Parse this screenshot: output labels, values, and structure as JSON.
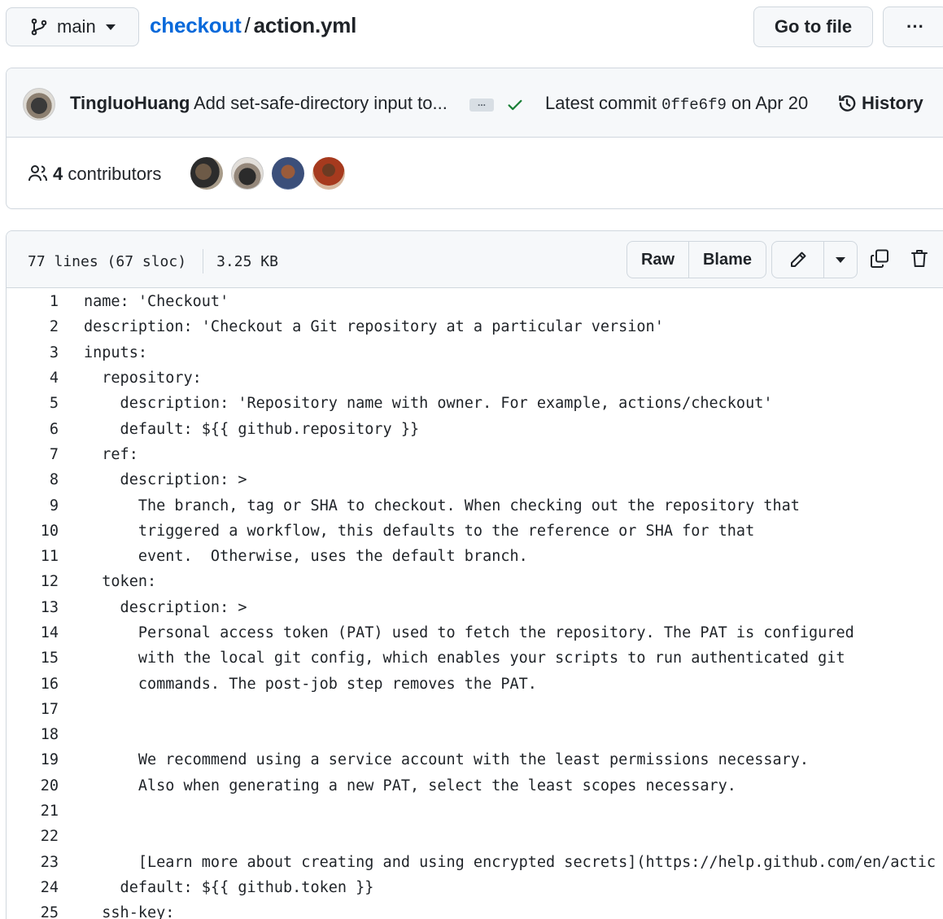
{
  "branch": {
    "name": "main",
    "icon": "git-branch-icon"
  },
  "path": {
    "repo": "checkout",
    "separator": "/",
    "file": "action.yml"
  },
  "toolbar": {
    "goto_file": "Go to file",
    "more": "···"
  },
  "commit": {
    "author": "TingluoHuang",
    "message": "Add set-safe-directory input to...",
    "ellipsis": "...",
    "latest_label": "Latest commit",
    "sha": "0ffe6f9",
    "date": "on Apr 20",
    "history": "History"
  },
  "contributors": {
    "count": "4",
    "label": "contributors"
  },
  "file": {
    "lines_info": "77 lines (67 sloc)",
    "size": "3.25 KB",
    "raw": "Raw",
    "blame": "Blame"
  },
  "code_lines": [
    {
      "n": "1",
      "text": "name: 'Checkout'"
    },
    {
      "n": "2",
      "text": "description: 'Checkout a Git repository at a particular version'"
    },
    {
      "n": "3",
      "text": "inputs:"
    },
    {
      "n": "4",
      "text": "  repository:"
    },
    {
      "n": "5",
      "text": "    description: 'Repository name with owner. For example, actions/checkout'"
    },
    {
      "n": "6",
      "text": "    default: ${{ github.repository }}"
    },
    {
      "n": "7",
      "text": "  ref:"
    },
    {
      "n": "8",
      "text": "    description: >"
    },
    {
      "n": "9",
      "text": "      The branch, tag or SHA to checkout. When checking out the repository that"
    },
    {
      "n": "10",
      "text": "      triggered a workflow, this defaults to the reference or SHA for that"
    },
    {
      "n": "11",
      "text": "      event.  Otherwise, uses the default branch."
    },
    {
      "n": "12",
      "text": "  token:"
    },
    {
      "n": "13",
      "text": "    description: >"
    },
    {
      "n": "14",
      "text": "      Personal access token (PAT) used to fetch the repository. The PAT is configured"
    },
    {
      "n": "15",
      "text": "      with the local git config, which enables your scripts to run authenticated git"
    },
    {
      "n": "16",
      "text": "      commands. The post-job step removes the PAT."
    },
    {
      "n": "17",
      "text": ""
    },
    {
      "n": "18",
      "text": ""
    },
    {
      "n": "19",
      "text": "      We recommend using a service account with the least permissions necessary."
    },
    {
      "n": "20",
      "text": "      Also when generating a new PAT, select the least scopes necessary."
    },
    {
      "n": "21",
      "text": ""
    },
    {
      "n": "22",
      "text": ""
    },
    {
      "n": "23",
      "text": "      [Learn more about creating and using encrypted secrets](https://help.github.com/en/actic"
    },
    {
      "n": "24",
      "text": "    default: ${{ github.token }}"
    },
    {
      "n": "25",
      "text": "  ssh-key:"
    }
  ]
}
